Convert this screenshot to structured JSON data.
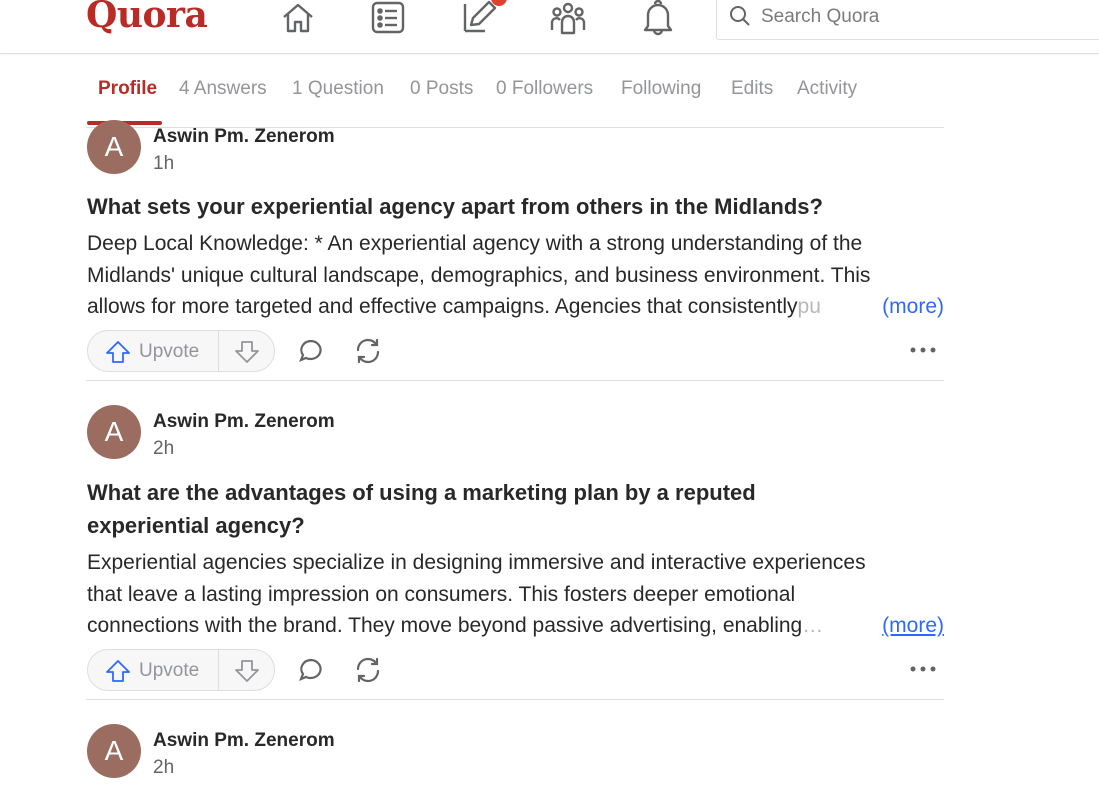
{
  "header": {
    "logo": "Quora",
    "search_placeholder": "Search Quora",
    "icons": [
      "home-icon",
      "answer-feed-icon",
      "write-icon",
      "spaces-icon",
      "notifications-icon",
      "search-icon"
    ]
  },
  "tabs": [
    {
      "label": "Profile",
      "active": true
    },
    {
      "label": "4 Answers"
    },
    {
      "label": "1 Question"
    },
    {
      "label": "0 Posts"
    },
    {
      "label": "0 Followers"
    },
    {
      "label": "Following"
    },
    {
      "label": "Edits"
    },
    {
      "label": "Activity"
    }
  ],
  "posts": [
    {
      "avatar_letter": "A",
      "author": "Aswin Pm. Zenerom",
      "time": "1h",
      "question_lines": [
        "What sets your experiential agency apart from others in the Midlands?"
      ],
      "answer_lines": [
        "Deep Local Knowledge: * An experiential agency with a strong understanding of the",
        "Midlands' unique cultural landscape, demographics, and business environment. This",
        "allows for more targeted and effective campaigns. Agencies that consistently"
      ],
      "answer_fade": "pu",
      "more": "(more)",
      "upvote": "Upvote"
    },
    {
      "avatar_letter": "A",
      "author": "Aswin Pm. Zenerom",
      "time": "2h",
      "question_lines": [
        "What are the advantages of using a marketing plan by a reputed",
        "experiential agency?"
      ],
      "answer_lines": [
        "Experiential agencies specialize in designing immersive and interactive experiences",
        "that leave a lasting impression on consumers. This fosters deeper emotional",
        "connections with the brand. They move beyond passive advertising, enabling"
      ],
      "answer_fade": "…",
      "more": "(more)",
      "upvote": "Upvote"
    },
    {
      "avatar_letter": "A",
      "author": "Aswin Pm. Zenerom",
      "time": "2h"
    }
  ],
  "colors": {
    "brand": "#b92b27",
    "link": "#2e69ff",
    "avatar": "#9b6c60"
  }
}
